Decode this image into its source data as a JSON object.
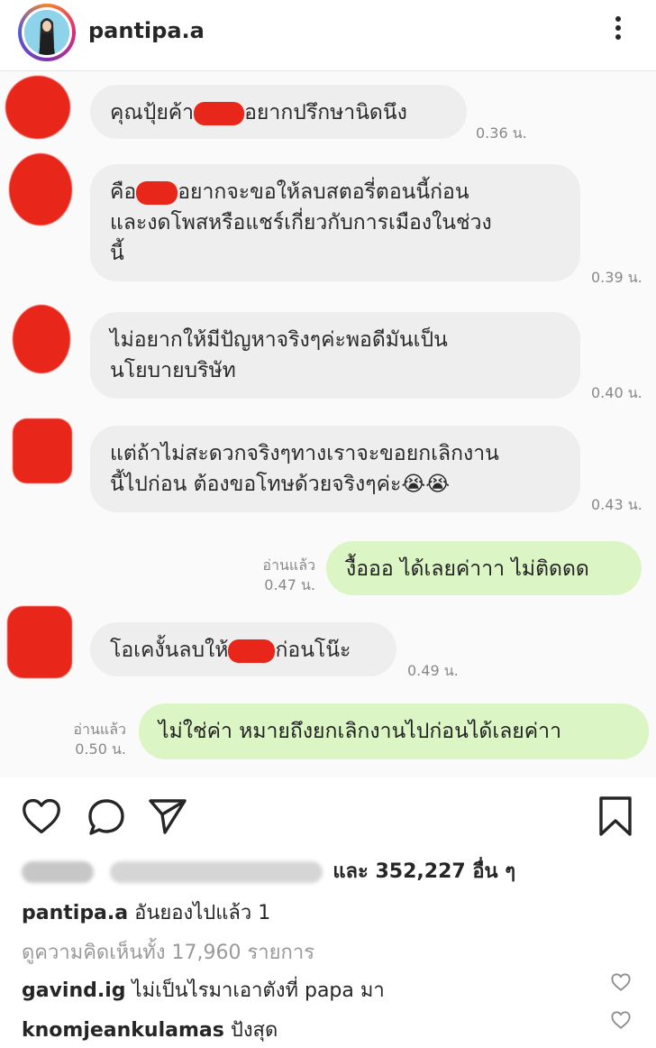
{
  "header": {
    "username": "pantipa.a"
  },
  "messages": [
    {
      "text_a": "คุณปุ้ยค้า",
      "text_b": "อยากปรึกษานิดนึง",
      "time": "0.36 น."
    },
    {
      "line1_a": "คือ",
      "line1_b": "อยากจะขอให้ลบสตอรี่ตอนนี้ก่อน",
      "line2": "และงดโพสหรือแชร์เกี่ยวกับการเมืองในช่วง",
      "line3": "นี้",
      "time": "0.39 น."
    },
    {
      "line1": "ไม่อยากให้มีปัญหาจริงๆค่ะพอดีมันเป็น",
      "line2": "นโยบายบริษัท",
      "time": "0.40 น."
    },
    {
      "line1": "แต่ถ้าไม่สะดวกจริงๆทางเราจะขอยกเลิกงาน",
      "line2": "นี้ไปก่อน ต้องขอโทษด้วยจริงๆค่ะ😭😭",
      "time": "0.43 น."
    },
    {
      "text": "งื้อออ ได้เลยค่าาา ไม่ติดดด",
      "read": "อ่านแล้ว",
      "time": "0.47 น."
    },
    {
      "text_a": "โอเคงั้นลบให้",
      "text_b": "ก่อนโน๊ะ",
      "time": "0.49 น."
    },
    {
      "text": "ไม่ใช่ค่า หมายถึงยกเลิกงานไปก่อนได้เลยค่าา",
      "read": "อ่านแล้ว",
      "time": "0.50 น."
    }
  ],
  "post": {
    "likes_suffix": "และ 352,227 อื่น ๆ",
    "caption_user": "pantipa.a",
    "caption_text": " อันยองไปแล้ว 1",
    "view_all": "ดูความคิดเห็นทั้ง 17,960 รายการ",
    "comments": [
      {
        "user": "gavind.ig",
        "text": " ไม่เป็นไรมาเอาตังที่ papa มา"
      },
      {
        "user": "knomjeankulamas",
        "text": " ปังสุด"
      }
    ]
  },
  "colors": {
    "incoming_bubble": "#eeeeee",
    "outgoing_bubble": "#dbf5c4",
    "redaction": "#e8261a"
  }
}
